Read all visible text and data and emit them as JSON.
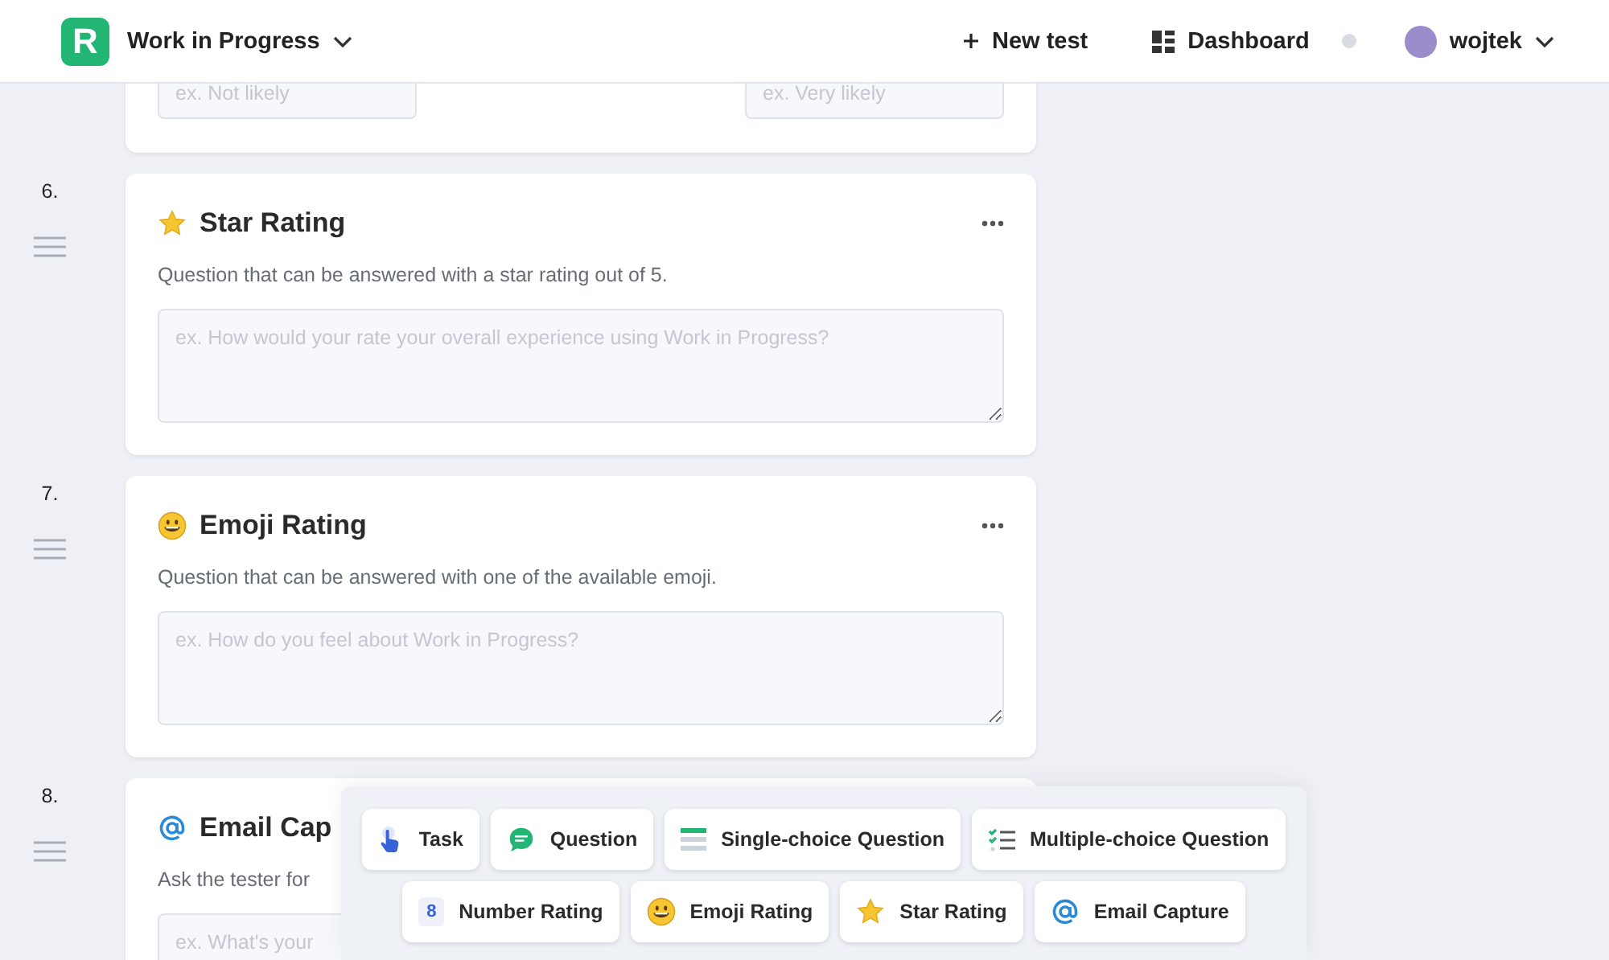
{
  "header": {
    "logo": "R",
    "project": "Work in Progress",
    "new_test": "New test",
    "dashboard": "Dashboard",
    "user": "wojtek"
  },
  "previous_card": {
    "fields": [
      {
        "placeholder": "ex. Not likely"
      },
      {
        "placeholder": "ex. Very likely"
      }
    ]
  },
  "questions": [
    {
      "number": "6.",
      "kind": "star",
      "title": "Star Rating",
      "description": "Question that can be answered with a star rating out of 5.",
      "placeholder": "ex. How would your rate your overall experience using Work in Progress?"
    },
    {
      "number": "7.",
      "kind": "emoji",
      "title": "Emoji Rating",
      "description": "Question that can be answered with one of the available emoji.",
      "placeholder": "ex. How do you feel about Work in Progress?"
    },
    {
      "number": "8.",
      "kind": "email",
      "title": "Email Cap",
      "description": "Ask the tester for",
      "placeholder": "ex. What's your"
    }
  ],
  "block_picker": {
    "items": [
      {
        "kind": "task",
        "label": "Task"
      },
      {
        "kind": "question",
        "label": "Question"
      },
      {
        "kind": "single",
        "label": "Single-choice Question"
      },
      {
        "kind": "multi",
        "label": "Multiple-choice Question"
      },
      {
        "kind": "number",
        "label": "Number Rating",
        "icon_text": "8"
      },
      {
        "kind": "emoji",
        "label": "Emoji Rating"
      },
      {
        "kind": "star",
        "label": "Star Rating"
      },
      {
        "kind": "email",
        "label": "Email Capture"
      }
    ]
  }
}
